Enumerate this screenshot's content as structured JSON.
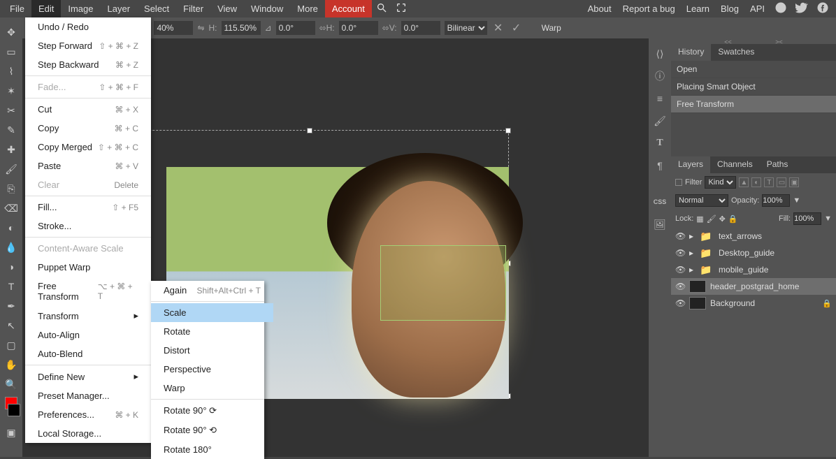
{
  "menubar": {
    "items": [
      "File",
      "Edit",
      "Image",
      "Layer",
      "Select",
      "Filter",
      "View",
      "Window",
      "More",
      "Account"
    ],
    "right": [
      "About",
      "Report a bug",
      "Learn",
      "Blog",
      "API"
    ]
  },
  "options": {
    "w": "40%",
    "h": "115.50%",
    "rot": "0.0°",
    "sh": "0.0°",
    "sv": "0.0°",
    "interp": "Bilinear",
    "warp": "Warp"
  },
  "edit_menu": [
    {
      "label": "Undo / Redo",
      "kb": ""
    },
    {
      "label": "Step Forward",
      "kb": "⇧ + ⌘ + Z"
    },
    {
      "label": "Step Backward",
      "kb": "⌘ + Z"
    },
    {
      "hr": true
    },
    {
      "label": "Fade...",
      "kb": "⇧ + ⌘ + F",
      "disabled": true
    },
    {
      "hr": true
    },
    {
      "label": "Cut",
      "kb": "⌘ + X"
    },
    {
      "label": "Copy",
      "kb": "⌘ + C"
    },
    {
      "label": "Copy Merged",
      "kb": "⇧ + ⌘ + C"
    },
    {
      "label": "Paste",
      "kb": "⌘ + V"
    },
    {
      "label": "Clear",
      "kb": "Delete",
      "disabled": true
    },
    {
      "hr": true
    },
    {
      "label": "Fill...",
      "kb": "⇧ + F5"
    },
    {
      "label": "Stroke...",
      "kb": ""
    },
    {
      "hr": true
    },
    {
      "label": "Content-Aware Scale",
      "kb": "",
      "disabled": true
    },
    {
      "label": "Puppet Warp",
      "kb": ""
    },
    {
      "label": "Free Transform",
      "kb": "⌥ + ⌘ + T"
    },
    {
      "label": "Transform",
      "sub": true
    },
    {
      "label": "Auto-Align",
      "kb": ""
    },
    {
      "label": "Auto-Blend",
      "kb": ""
    },
    {
      "hr": true
    },
    {
      "label": "Define New",
      "sub": true
    },
    {
      "label": "Preset Manager...",
      "kb": ""
    },
    {
      "label": "Preferences...",
      "kb": "⌘ + K"
    },
    {
      "label": "Local Storage...",
      "kb": ""
    }
  ],
  "transform_submenu": [
    {
      "label": "Again",
      "kb": "Shift+Alt+Ctrl + T"
    },
    {
      "hr": true
    },
    {
      "label": "Scale",
      "highlight": true
    },
    {
      "label": "Rotate"
    },
    {
      "label": "Distort"
    },
    {
      "label": "Perspective"
    },
    {
      "label": "Warp"
    },
    {
      "hr": true
    },
    {
      "label": "Rotate 90° ⟳"
    },
    {
      "label": "Rotate 90° ⟲"
    },
    {
      "label": "Rotate 180°"
    }
  ],
  "history": {
    "tabs": [
      "History",
      "Swatches"
    ],
    "items": [
      "Open",
      "Placing Smart Object",
      "Free Transform"
    ]
  },
  "layers": {
    "tabs": [
      "Layers",
      "Channels",
      "Paths"
    ],
    "filter_label": "Filter",
    "filter_kind": "Kind",
    "blend": "Normal",
    "opacity_label": "Opacity:",
    "opacity": "100%",
    "lock_label": "Lock:",
    "fill_label": "Fill:",
    "fill": "100%",
    "items": [
      {
        "name": "text_arrows",
        "folder": true
      },
      {
        "name": "Desktop_guide",
        "folder": true
      },
      {
        "name": "mobile_guide",
        "folder": true
      },
      {
        "name": "header_postgrad_home",
        "selected": true
      },
      {
        "name": "Background",
        "lock": true
      }
    ]
  }
}
